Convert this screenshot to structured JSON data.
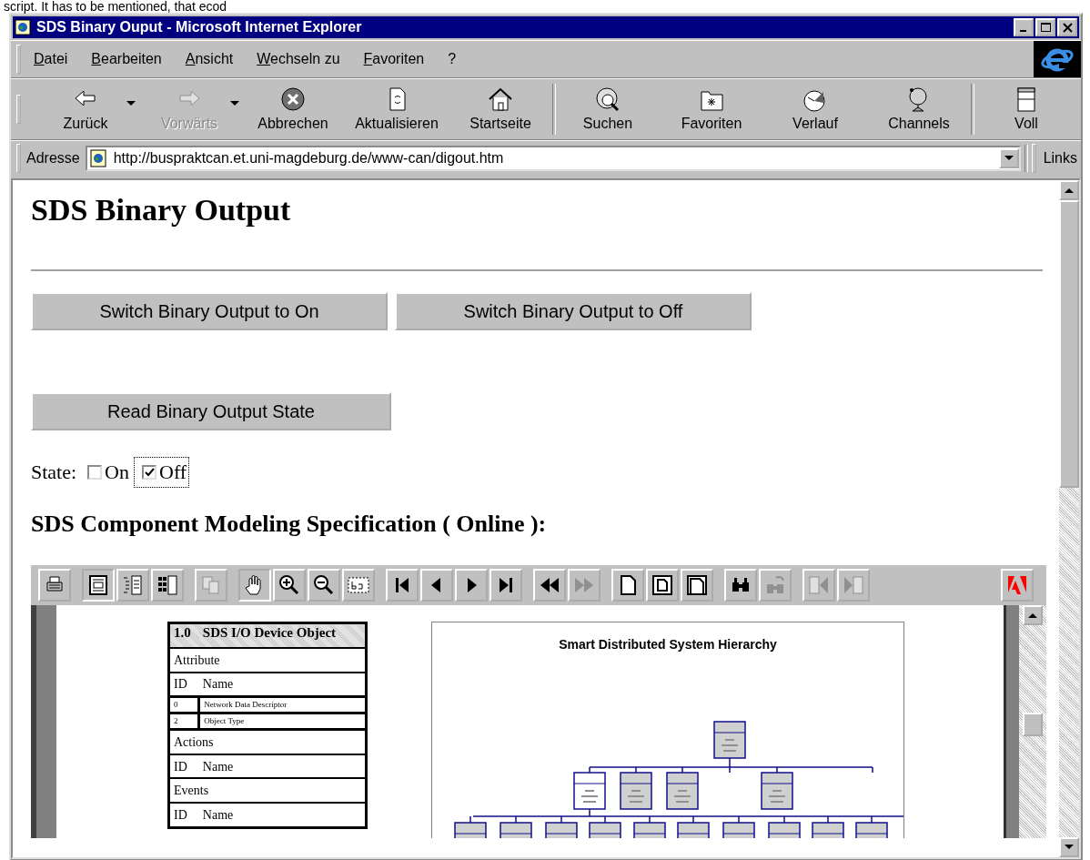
{
  "caption_fragment": "script. It has to be mentioned, that ecod",
  "window": {
    "title": "SDS Binary Ouput - Microsoft Internet Explorer"
  },
  "menu": [
    {
      "label": "Datei"
    },
    {
      "label": "Bearbeiten"
    },
    {
      "label": "Ansicht"
    },
    {
      "label": "Wechseln zu"
    },
    {
      "label": "Favoriten"
    },
    {
      "label": "?"
    }
  ],
  "toolbar": [
    [
      {
        "kind": "back",
        "label": "Zurück",
        "disabled": false,
        "dropdown": true
      },
      {
        "kind": "forward",
        "label": "Vorwärts",
        "disabled": true,
        "dropdown": true
      },
      {
        "kind": "stop",
        "label": "Abbrechen",
        "disabled": false,
        "dropdown": false
      },
      {
        "kind": "refresh",
        "label": "Aktualisieren",
        "disabled": false,
        "dropdown": false
      },
      {
        "kind": "home",
        "label": "Startseite",
        "disabled": false,
        "dropdown": false
      }
    ],
    [
      {
        "kind": "search",
        "label": "Suchen",
        "disabled": false,
        "dropdown": false
      },
      {
        "kind": "favorites",
        "label": "Favoriten",
        "disabled": false,
        "dropdown": false
      },
      {
        "kind": "history",
        "label": "Verlauf",
        "disabled": false,
        "dropdown": false
      },
      {
        "kind": "channels",
        "label": "Channels",
        "disabled": false,
        "dropdown": false
      }
    ],
    [
      {
        "kind": "fullscreen",
        "label": "Voll",
        "disabled": false,
        "dropdown": false
      }
    ]
  ],
  "address_bar": {
    "label": "Adresse",
    "value": "http://buspraktcan.et.uni-magdeburg.de/www-can/digout.htm",
    "links": "Links"
  },
  "page": {
    "heading": "SDS Binary Output",
    "switch_buttons": [
      "Switch Binary Output to On",
      "Switch Binary Output to Off"
    ],
    "read_button": "Read Binary Output State",
    "state_label": "State:",
    "checkboxes": [
      {
        "label": "On",
        "checked": false,
        "focused": false
      },
      {
        "label": "Off",
        "checked": true,
        "focused": true
      }
    ],
    "subheading": "SDS Component Modeling Specification ( Online ):"
  },
  "pdf_viewer": {
    "tool_groups": [
      [
        {
          "kind": "print",
          "pressed": false,
          "disabled": false
        }
      ],
      [
        {
          "kind": "page-only",
          "pressed": true,
          "disabled": false
        },
        {
          "kind": "bookmarks",
          "pressed": false,
          "disabled": false
        },
        {
          "kind": "thumbnails",
          "pressed": false,
          "disabled": false
        }
      ],
      [
        {
          "kind": "copy",
          "pressed": false,
          "disabled": true
        }
      ],
      [
        {
          "kind": "hand",
          "pressed": true,
          "disabled": false
        },
        {
          "kind": "zoom-in",
          "pressed": false,
          "disabled": false
        },
        {
          "kind": "zoom-out",
          "pressed": false,
          "disabled": false
        },
        {
          "kind": "text-select",
          "pressed": false,
          "disabled": false
        }
      ],
      [
        {
          "kind": "first",
          "pressed": false,
          "disabled": false
        },
        {
          "kind": "prev",
          "pressed": false,
          "disabled": false
        },
        {
          "kind": "next",
          "pressed": false,
          "disabled": false
        },
        {
          "kind": "last",
          "pressed": false,
          "disabled": false
        }
      ],
      [
        {
          "kind": "go-back",
          "pressed": false,
          "disabled": false
        },
        {
          "kind": "go-forward",
          "pressed": false,
          "disabled": true
        }
      ],
      [
        {
          "kind": "actual-size",
          "pressed": false,
          "disabled": false
        },
        {
          "kind": "fit-page",
          "pressed": false,
          "disabled": false
        },
        {
          "kind": "fit-width",
          "pressed": false,
          "disabled": false
        }
      ],
      [
        {
          "kind": "find",
          "pressed": false,
          "disabled": false
        },
        {
          "kind": "find-next",
          "pressed": false,
          "disabled": true
        }
      ],
      [
        {
          "kind": "prev-article",
          "pressed": false,
          "disabled": true
        },
        {
          "kind": "next-article",
          "pressed": false,
          "disabled": true
        }
      ],
      [
        {
          "kind": "adobe",
          "pressed": false,
          "disabled": false
        }
      ]
    ],
    "table": {
      "number": "1.0",
      "title": "SDS I/O Device Object",
      "rows": [
        {
          "kind": "section",
          "text": "Attribute"
        },
        {
          "kind": "columns",
          "id": "ID",
          "name": "Name"
        },
        {
          "kind": "entry",
          "id": "0",
          "name": "Network Data Descriptor"
        },
        {
          "kind": "entry",
          "id": "2",
          "name": "Object Type"
        },
        {
          "kind": "section",
          "text": "Actions"
        },
        {
          "kind": "columns",
          "id": "ID",
          "name": "Name"
        },
        {
          "kind": "section",
          "text": "Events"
        },
        {
          "kind": "columns",
          "id": "ID",
          "name": "Name"
        }
      ]
    },
    "diagram": {
      "title": "Smart Distributed System Hierarchy"
    }
  }
}
